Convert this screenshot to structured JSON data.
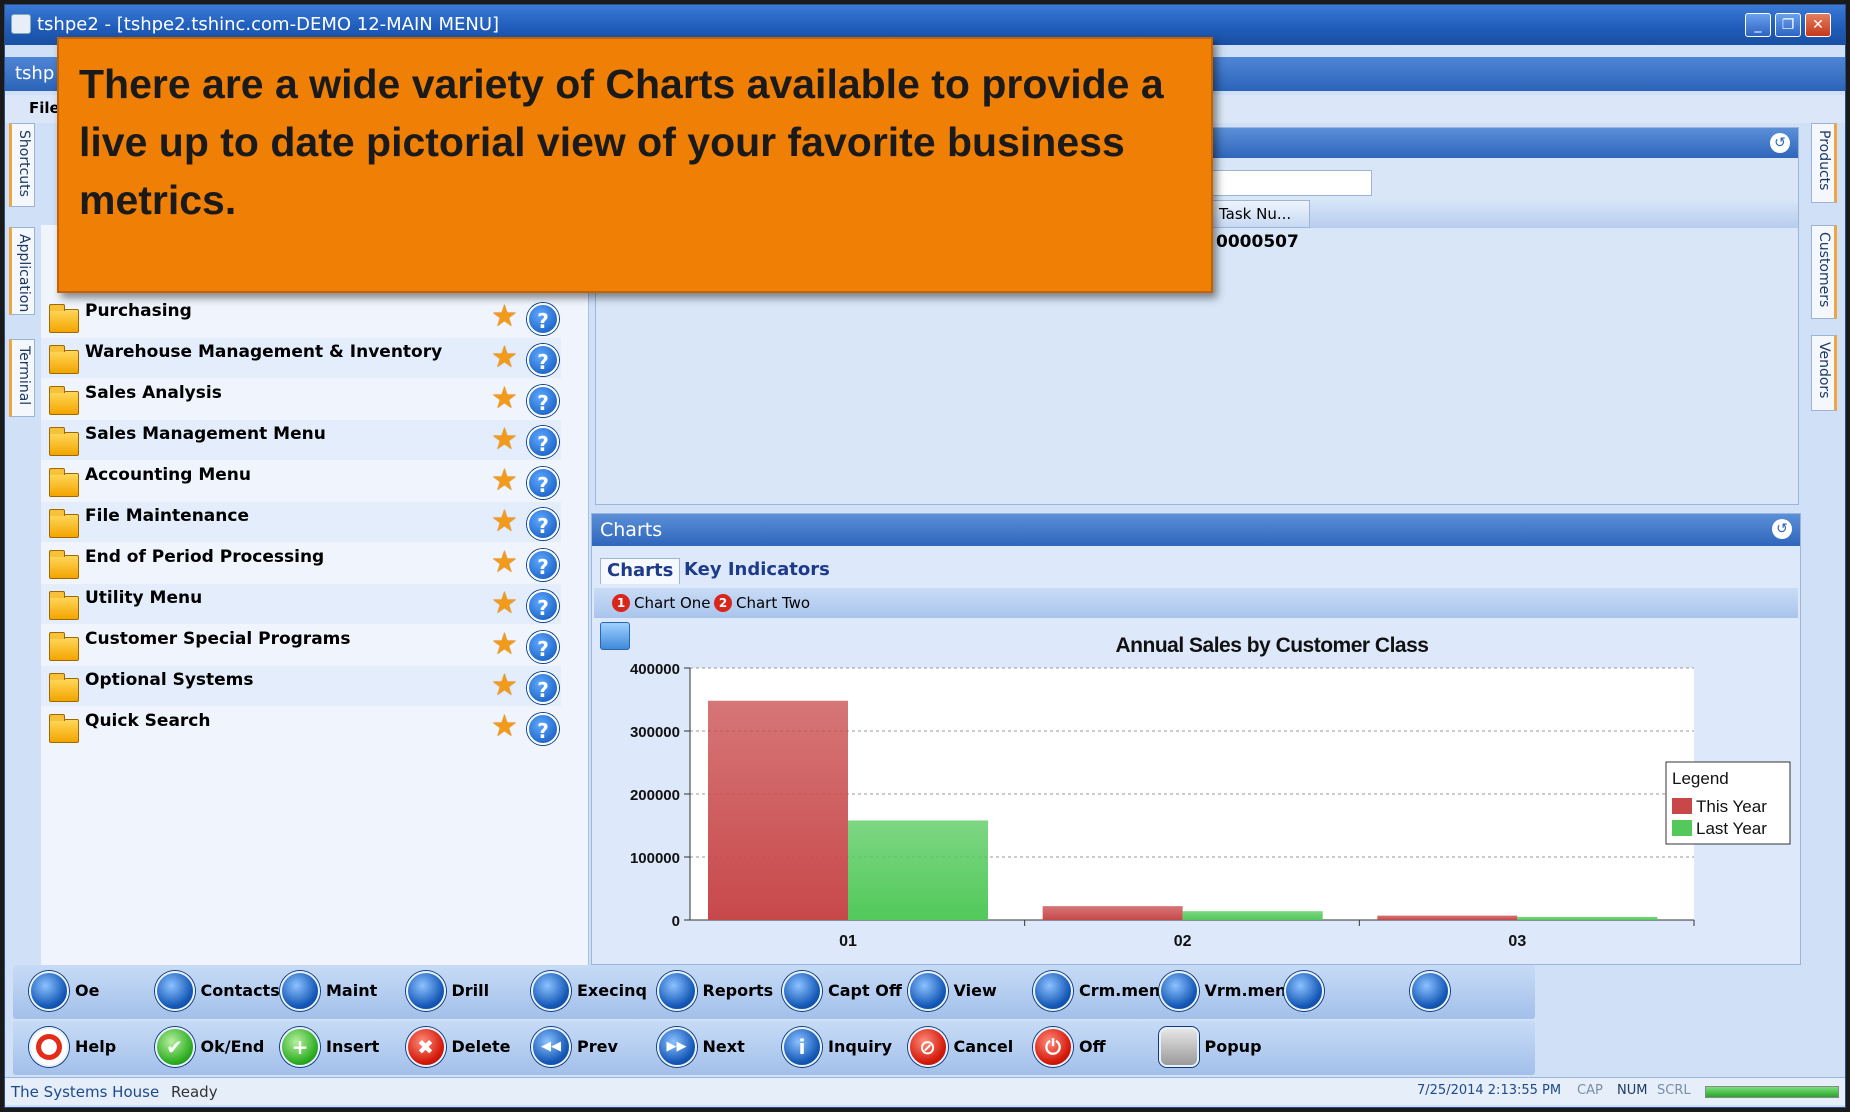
{
  "window": {
    "title": "tshpe2 - [tshpe2.tshinc.com-DEMO 12-MAIN MENU]",
    "app_bar_label": "tshp",
    "menu_file": "File",
    "minimize": "_",
    "restore": "❐",
    "close": "✕"
  },
  "callout": {
    "text": "There are a wide variety of Charts available to provide a live up to date pictorial view of your favorite business metrics."
  },
  "left_tabs": [
    "Shortcuts",
    "Application",
    "Terminal"
  ],
  "right_tabs": [
    "Products",
    "Customers",
    "Vendors"
  ],
  "menu_items": [
    "Purchasing",
    "Warehouse Management & Inventory",
    "Sales Analysis",
    "Sales Management Menu",
    "Accounting Menu",
    "File Maintenance",
    "End of Period Processing",
    "Utility Menu",
    "Customer Special Programs",
    "Optional Systems",
    "Quick Search"
  ],
  "task_panel": {
    "column_header": "Task Nu...",
    "cell_value": "0000507"
  },
  "charts_panel": {
    "title": "Charts",
    "tabs": [
      "Charts",
      "Key Indicators"
    ],
    "toolbar": [
      {
        "badge": "1",
        "label": "Chart One"
      },
      {
        "badge": "2",
        "label": "Chart Two"
      }
    ]
  },
  "chart_data": {
    "type": "bar",
    "title": "Annual Sales by Customer Class",
    "categories": [
      "01",
      "02",
      "03"
    ],
    "series": [
      {
        "name": "This Year",
        "values": [
          348000,
          22000,
          7000
        ],
        "color": "#c8484a"
      },
      {
        "name": "Last Year",
        "values": [
          158000,
          14000,
          5000
        ],
        "color": "#52c95a"
      }
    ],
    "ylim": [
      0,
      400000
    ],
    "yticks": [
      0,
      100000,
      200000,
      300000,
      400000
    ],
    "legend_title": "Legend",
    "legend_position": "right",
    "grid": true
  },
  "command_bar_1": [
    {
      "label": "Oe",
      "icon": "globe-icon"
    },
    {
      "label": "Contacts",
      "icon": "globe-icon"
    },
    {
      "label": "Maint",
      "icon": "globe-icon"
    },
    {
      "label": "Drill",
      "icon": "globe-icon"
    },
    {
      "label": "Execinq",
      "icon": "globe-icon"
    },
    {
      "label": "Reports",
      "icon": "globe-icon"
    },
    {
      "label": "Capt Off",
      "icon": "globe-icon"
    },
    {
      "label": "View",
      "icon": "globe-icon"
    },
    {
      "label": "Crm.menu",
      "icon": "globe-icon"
    },
    {
      "label": "Vrm.menu",
      "icon": "globe-icon"
    },
    {
      "label": "",
      "icon": "globe-icon"
    },
    {
      "label": "",
      "icon": "globe-icon"
    }
  ],
  "command_bar_2": [
    {
      "label": "Help",
      "icon": "lifebuoy-icon"
    },
    {
      "label": "Ok/End",
      "icon": "check-icon"
    },
    {
      "label": "Insert",
      "icon": "plus-icon"
    },
    {
      "label": "Delete",
      "icon": "x-icon"
    },
    {
      "label": "Prev",
      "icon": "rewind-icon"
    },
    {
      "label": "Next",
      "icon": "fast-forward-icon"
    },
    {
      "label": "Inquiry",
      "icon": "info-icon"
    },
    {
      "label": "Cancel",
      "icon": "cancel-icon"
    },
    {
      "label": "Off",
      "icon": "power-icon"
    },
    {
      "label": "Popup",
      "icon": "database-icon"
    }
  ],
  "status": {
    "company": "The Systems House",
    "state": "Ready",
    "datetime": "7/25/2014 2:13:55 PM",
    "cap": "CAP",
    "num": "NUM",
    "scrl": "SCRL"
  }
}
